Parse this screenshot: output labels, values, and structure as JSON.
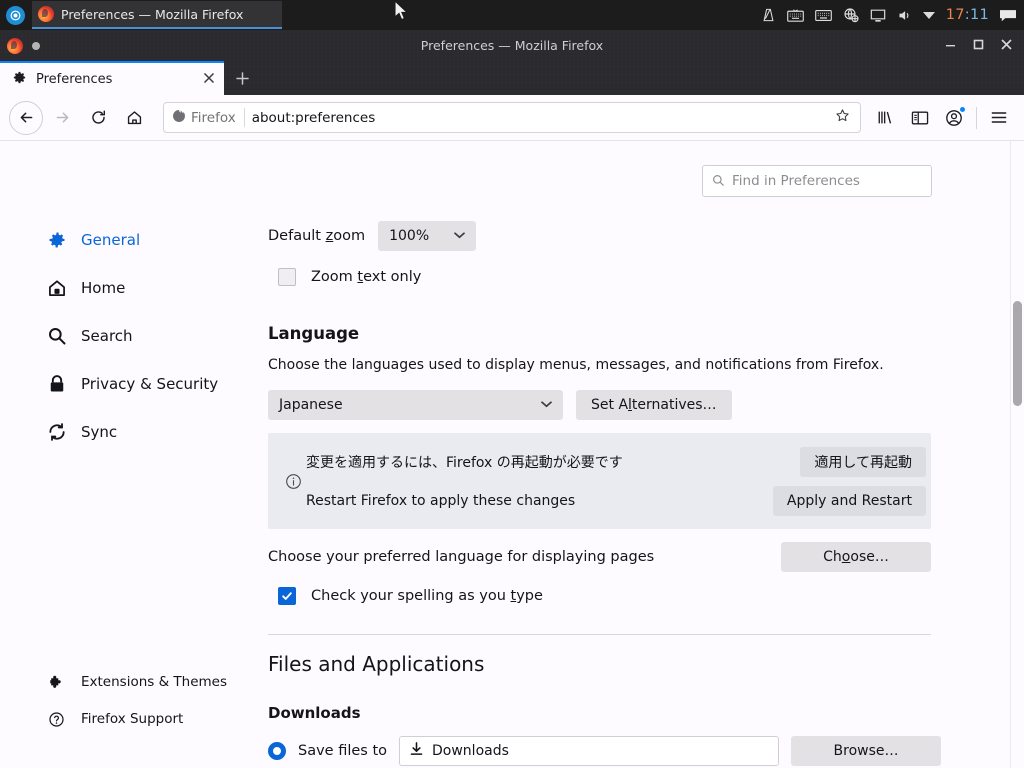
{
  "os_taskbar": {
    "logo_glyph": "◎",
    "window_button": {
      "title": "Preferences — Mozilla Firefox",
      "icon": "firefox-logo"
    },
    "tray": {
      "icons": [
        "metronome-icon",
        "keyboard-icon",
        "keyboard-layout-icon",
        "network-globe-icon",
        "display-icon",
        "volume-icon",
        "chevron-down-icon"
      ],
      "clock_hours": "17",
      "clock_separator": ":",
      "clock_minutes": "11",
      "notification_icon": "notification-icon"
    }
  },
  "window": {
    "title": "Preferences — Mozilla Firefox",
    "minimize_label": "—",
    "maximize_label": "□",
    "close_label": "✕"
  },
  "tabs": {
    "active": {
      "icon": "gear-icon",
      "title": "Preferences",
      "close_label": "✕"
    },
    "new_tab_label": "+"
  },
  "toolbar": {
    "back_label": "←",
    "forward_label": "→",
    "reload_label": "⟳",
    "home_label": "⌂",
    "identity_label": "Firefox",
    "url": "about:preferences",
    "bookmark_label": "☆",
    "library_icon": "library-icon",
    "sidebar_icon": "sidebar-icon",
    "account_icon": "account-icon",
    "menu_label": "☰"
  },
  "search": {
    "placeholder": "Find in Preferences",
    "value": "",
    "icon": "search-icon"
  },
  "sidebar": {
    "items": [
      {
        "label": "General",
        "icon": "gear-icon",
        "active": true
      },
      {
        "label": "Home",
        "icon": "home-icon",
        "active": false
      },
      {
        "label": "Search",
        "icon": "search-icon",
        "active": false
      },
      {
        "label": "Privacy & Security",
        "icon": "lock-icon",
        "active": false
      },
      {
        "label": "Sync",
        "icon": "sync-icon",
        "active": false
      }
    ],
    "bottom_items": [
      {
        "label": "Extensions & Themes",
        "icon": "puzzle-icon"
      },
      {
        "label": "Firefox Support",
        "icon": "question-circle-icon"
      }
    ]
  },
  "main": {
    "zoom": {
      "label_pre": "Default ",
      "label_ak": "z",
      "label_post": "oom",
      "value": "100%",
      "chevron": "⌄",
      "text_only_pre": "Zoom ",
      "text_only_ak": "t",
      "text_only_post": "ext only",
      "text_only_checked": false
    },
    "language": {
      "heading": "Language",
      "description": "Choose the languages used to display menus, messages, and notifications from Firefox.",
      "selected": "Japanese",
      "chevron": "⌄",
      "alternatives_pre": "Set A",
      "alternatives_ak": "l",
      "alternatives_post": "ternatives…"
    },
    "restart_notice": {
      "info_icon": "info-circle-icon",
      "message_ja": "変更を適用するには、Firefox の再起動が必要です",
      "button_ja": "適用して再起動",
      "message_en": "Restart Firefox to apply these changes",
      "button_en": "Apply and Restart"
    },
    "preferred_language": {
      "label": "Choose your preferred language for displaying pages",
      "button_pre": "Ch",
      "button_ak": "o",
      "button_post": "ose…"
    },
    "spellcheck": {
      "label_pre": "Check your spelling as you ",
      "label_ak": "t",
      "label_post": "ype",
      "checked": true,
      "check_glyph": "✓"
    },
    "files_and_apps": {
      "heading": "Files and Applications",
      "downloads_heading": "Downloads",
      "save_files_label": "Save files to",
      "download_path": "Downloads",
      "download_icon": "download-icon",
      "browse_label": "Browse…"
    }
  },
  "colors": {
    "accent": "#0a66d8",
    "tab_accent": "#0a84ff",
    "page_bg": "#fdfbff",
    "notice_bg": "#eaeaf1",
    "button_bg": "#e4e1e5",
    "chrome_dark": "#2b2a2e"
  }
}
